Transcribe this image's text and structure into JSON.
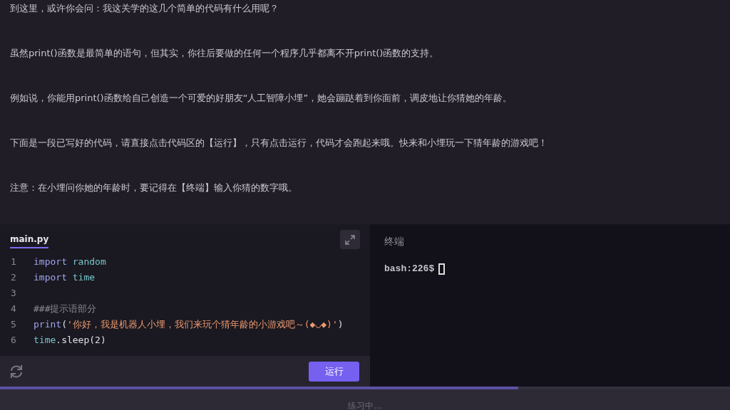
{
  "paragraphs": [
    "到这里，或许你会问：我这关学的这几个简单的代码有什么用呢？",
    "虽然print()函数是最简单的语句，但其实，你往后要做的任何一个程序几乎都离不开print()函数的支持。",
    "例如说，你能用print()函数给自己创造一个可爱的好朋友“人工智障小埋”，她会蹦跶着到你面前，调皮地让你猜她的年龄。",
    "下面是一段已写好的代码，请直接点击代码区的【运行】，只有点击运行，代码才会跑起来哦。快来和小埋玩一下猜年龄的游戏吧！",
    "注意：在小埋问你她的年龄时，要记得在【终端】输入你猜的数字哦。"
  ],
  "editor": {
    "tab": {
      "label": "main.py",
      "selected": true
    },
    "lines": [
      {
        "number": "1",
        "tokens": [
          {
            "kind": "keyword",
            "text": "import"
          },
          {
            "kind": "name",
            "text": "random",
            "spaced": true
          }
        ]
      },
      {
        "number": "2",
        "tokens": [
          {
            "kind": "keyword",
            "text": "import"
          },
          {
            "kind": "name",
            "text": "time",
            "spaced": true
          }
        ]
      },
      {
        "number": "3"
      },
      {
        "number": "4",
        "tokens": [
          {
            "kind": "comment",
            "text": "###提示语部分"
          }
        ]
      },
      {
        "number": "5",
        "tokens": [
          {
            "kind": "keyword",
            "text": "print"
          },
          {
            "kind": "plain",
            "text": "("
          },
          {
            "kind": "string",
            "text": "'你好，我是机器人小埋，我们来玩个猜年龄的小游戏吧～(◆◡◆)'"
          },
          {
            "kind": "plain",
            "text": ")"
          }
        ]
      },
      {
        "number": "6",
        "tokens": [
          {
            "kind": "name",
            "text": "time"
          },
          {
            "kind": "plain",
            "text": ".sleep("
          },
          {
            "kind": "number",
            "text": "2"
          },
          {
            "kind": "plain",
            "text": ")"
          }
        ]
      }
    ],
    "run_button": "运行"
  },
  "terminal": {
    "title": "终端",
    "prompt": "bash:226$"
  },
  "progress": {
    "level": 0.71
  },
  "status": "练习中..."
}
